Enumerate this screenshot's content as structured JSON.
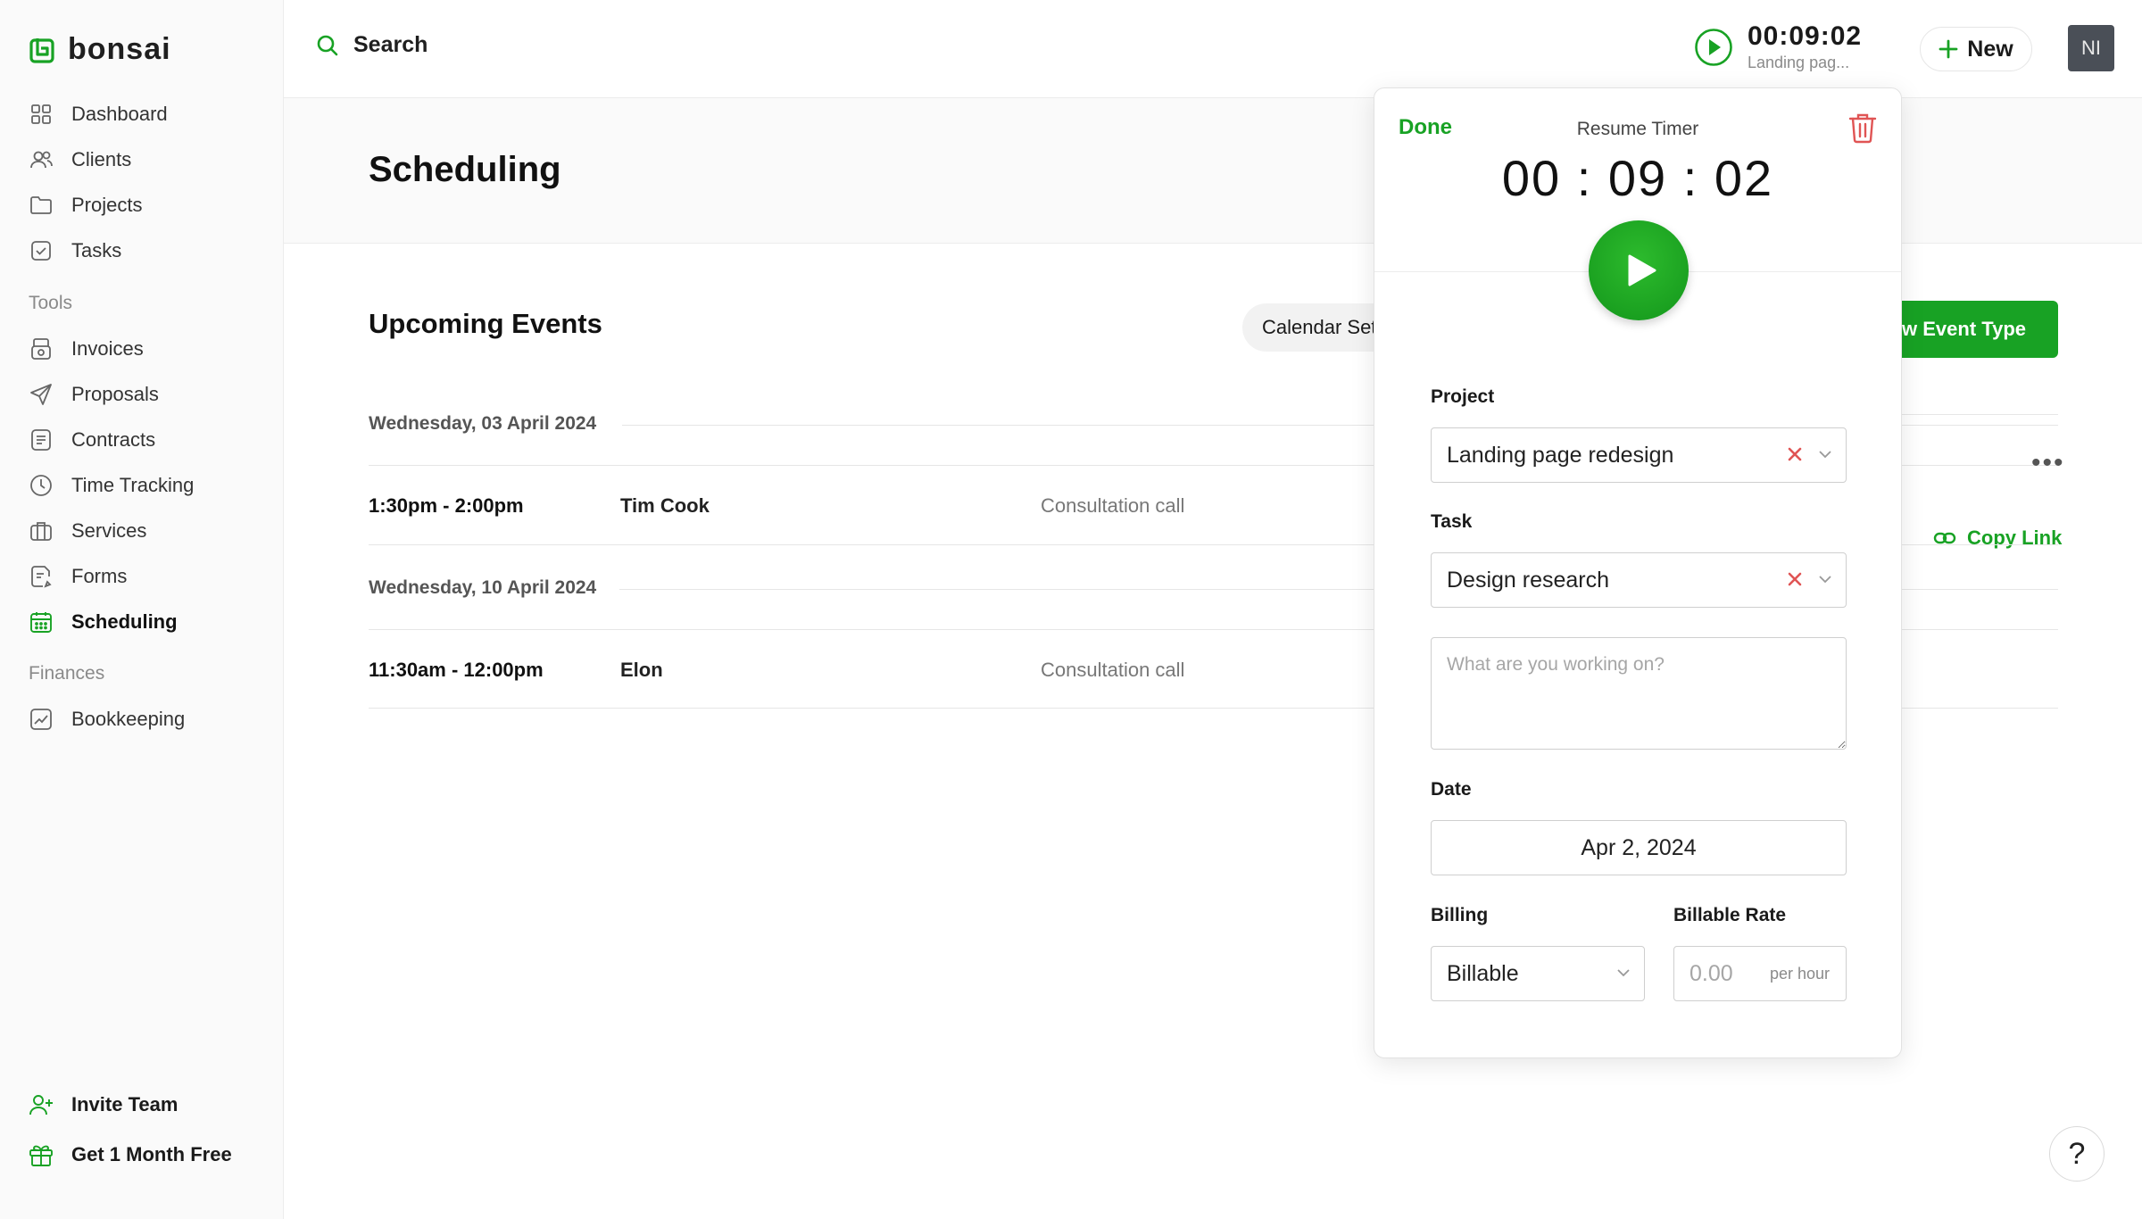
{
  "app": {
    "brand": "bonsai"
  },
  "colors": {
    "accent": "#18a224",
    "danger": "#e05454"
  },
  "sidebar": {
    "items": [
      {
        "label": "Dashboard",
        "icon": "grid-icon"
      },
      {
        "label": "Clients",
        "icon": "users-icon"
      },
      {
        "label": "Projects",
        "icon": "folder-icon"
      },
      {
        "label": "Tasks",
        "icon": "checkbox-icon"
      }
    ],
    "tools_label": "Tools",
    "tools": [
      {
        "label": "Invoices",
        "icon": "invoice-icon"
      },
      {
        "label": "Proposals",
        "icon": "send-icon"
      },
      {
        "label": "Contracts",
        "icon": "document-icon"
      },
      {
        "label": "Time Tracking",
        "icon": "clock-icon"
      },
      {
        "label": "Services",
        "icon": "briefcase-icon"
      },
      {
        "label": "Forms",
        "icon": "form-icon"
      },
      {
        "label": "Scheduling",
        "icon": "calendar-icon",
        "active": true
      }
    ],
    "finances_label": "Finances",
    "finances": [
      {
        "label": "Bookkeeping",
        "icon": "chart-icon"
      }
    ],
    "footer": [
      {
        "label": "Invite Team",
        "icon": "user-plus-icon"
      },
      {
        "label": "Get 1 Month Free",
        "icon": "gift-icon"
      }
    ]
  },
  "topbar": {
    "search_label": "Search",
    "timer_time": "00:09:02",
    "timer_project": "Landing pag...",
    "new_label": "New",
    "avatar_initials": "NI"
  },
  "page": {
    "title": "Scheduling",
    "section_title": "Upcoming Events",
    "calendar_btn": "Calendar Settings",
    "new_event_btn": "New Event Type",
    "copy_link": "Copy Link",
    "more": "•••"
  },
  "events": [
    {
      "date": "Wednesday, 03 April 2024",
      "time": "1:30pm - 2:00pm",
      "name": "Tim Cook",
      "type": "Consultation call"
    },
    {
      "date": "Wednesday, 10 April 2024",
      "time": "11:30am - 12:00pm",
      "name": "Elon",
      "type": "Consultation call"
    }
  ],
  "timer_popup": {
    "done_label": "Done",
    "resume_label": "Resume Timer",
    "time_display": "00 : 09 : 02",
    "project_label": "Project",
    "project_value": "Landing page redesign",
    "task_label": "Task",
    "task_value": "Design research",
    "notes_placeholder": "What are you working on?",
    "date_label": "Date",
    "date_value": "Apr 2, 2024",
    "billing_label": "Billing",
    "billing_value": "Billable",
    "rate_label": "Billable Rate",
    "rate_value": "0.00",
    "rate_unit": "per hour"
  },
  "help_label": "?"
}
